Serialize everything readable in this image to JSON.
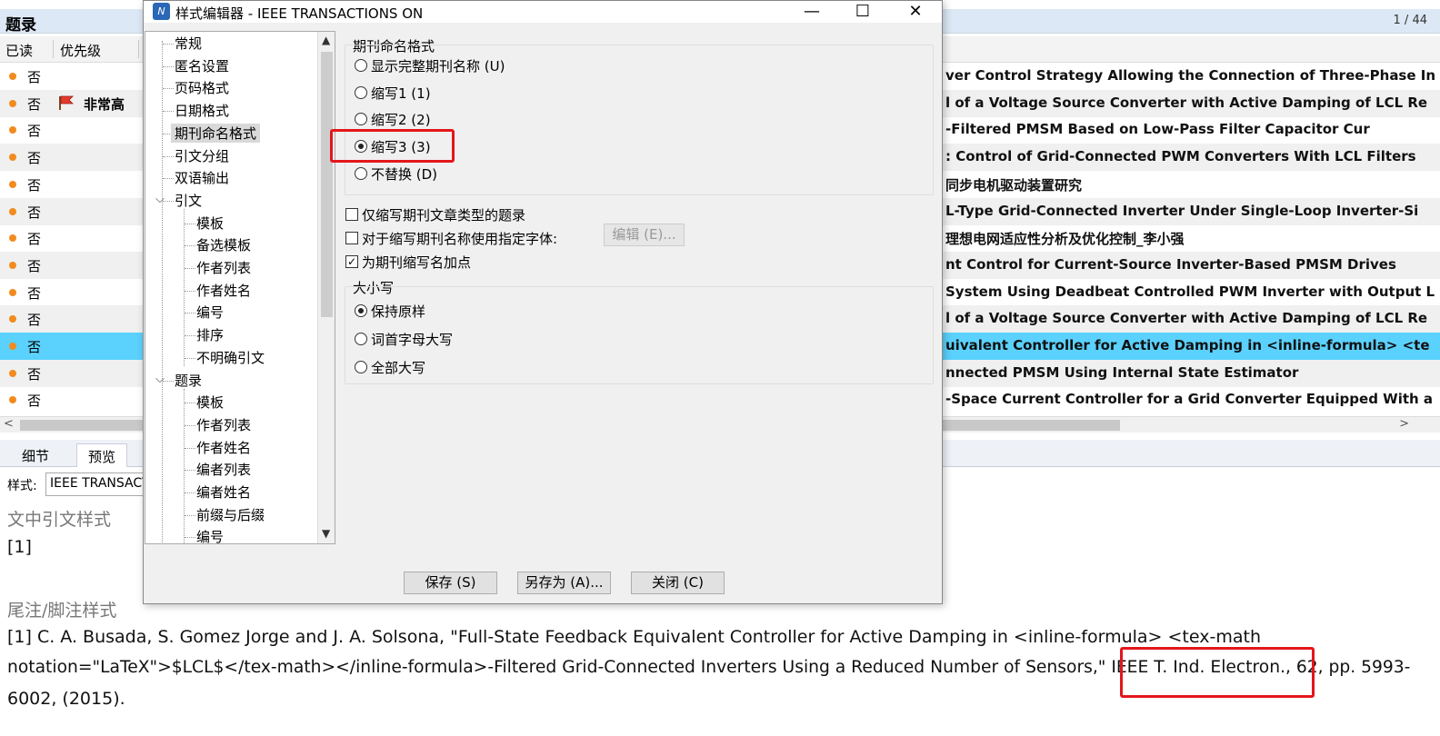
{
  "library": {
    "pane_title": "题录",
    "page_counter": "1 / 44",
    "columns": {
      "read": "已读",
      "priority": "优先级"
    },
    "rows": [
      {
        "read": "否",
        "priority": "",
        "title": "ver Control Strategy Allowing the Connection of Three-Phase In"
      },
      {
        "read": "否",
        "priority": "非常高",
        "title": "l of a Voltage Source Converter with Active Damping of LCL Re"
      },
      {
        "read": "否",
        "priority": "",
        "title": "-Filtered PMSM Based on Low-Pass Filter Capacitor Cur"
      },
      {
        "read": "否",
        "priority": "",
        "title": ": Control of Grid-Connected PWM Converters With LCL Filters"
      },
      {
        "read": "否",
        "priority": "",
        "title": "同步电机驱动装置研究"
      },
      {
        "read": "否",
        "priority": "",
        "title": "L-Type Grid-Connected Inverter Under Single-Loop Inverter-Si"
      },
      {
        "read": "否",
        "priority": "",
        "title": "理想电网适应性分析及优化控制_李小强"
      },
      {
        "read": "否",
        "priority": "",
        "title": "nt Control for Current-Source Inverter-Based PMSM Drives"
      },
      {
        "read": "否",
        "priority": "",
        "title": "System Using Deadbeat Controlled PWM Inverter with Output L"
      },
      {
        "read": "否",
        "priority": "",
        "title": "l of a Voltage Source Converter with Active Damping of LCL Re"
      },
      {
        "read": "否",
        "priority": "",
        "title": "uivalent Controller for Active Damping in <inline-formula> <te"
      },
      {
        "read": "否",
        "priority": "",
        "title": "nnected PMSM Using Internal State Estimator"
      },
      {
        "read": "否",
        "priority": "",
        "title": "-Space Current Controller for a Grid Converter Equipped With a"
      }
    ],
    "selected_row": 10,
    "tabs": [
      "细节",
      "预览"
    ],
    "style_label": "样式:",
    "style_value": "IEEE TRANSACTIONS ON",
    "preview": {
      "intext_heading": "文中引文样式",
      "intext_value": "[1]",
      "footnote_heading": "尾注/脚注样式",
      "line1": "[1]     C. A. Busada, S. Gomez Jorge and J. A. Solsona, \"Full-State Feedback Equivalent Controller for Active Damping in <inline-formula> <tex-math",
      "line2": "notation=\"LaTeX\">$LCL$</tex-math></inline-formula>-Filtered Grid-Connected Inverters Using a Reduced Number of Sensors,\" IEEE T. Ind. Electron., 62, pp. 5993-",
      "line3": "6002, (2015)."
    }
  },
  "dialog": {
    "title": "样式编辑器 - IEEE TRANSACTIONS ON",
    "icon_text": "N",
    "controls": {
      "minimize": "—",
      "maximize": "☐",
      "close": "✕"
    },
    "tree": {
      "items": [
        "常规",
        "匿名设置",
        "页码格式",
        "日期格式",
        "期刊命名格式",
        "引文分组",
        "双语输出",
        "引文",
        "模板",
        "备选模板",
        "作者列表",
        "作者姓名",
        "编号",
        "排序",
        "不明确引文",
        "题录",
        "模板",
        "作者列表",
        "作者姓名",
        "编者列表",
        "编者姓名",
        "前缀与后缀",
        "编号"
      ]
    },
    "journal_group": {
      "title": "期刊命名格式",
      "options": [
        "显示完整期刊名称 (U)",
        "缩写1 (1)",
        "缩写2 (2)",
        "缩写3 (3)",
        "不替换 (D)"
      ],
      "selected": 3
    },
    "checks": {
      "only_journal": "仅缩写期刊文章类型的题录",
      "use_font": "对于缩写期刊名称使用指定字体:",
      "add_period": "为期刊缩写名加点",
      "edit_button": "编辑 (E)..."
    },
    "case_group": {
      "title": "大小写",
      "options": [
        "保持原样",
        "词首字母大写",
        "全部大写"
      ],
      "selected": 0
    },
    "buttons": {
      "save": "保存 (S)",
      "save_as": "另存为 (A)...",
      "close": "关闭 (C)"
    }
  }
}
